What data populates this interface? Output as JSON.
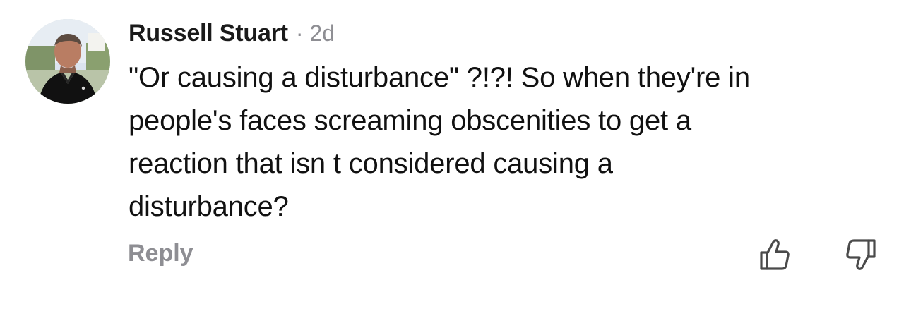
{
  "comment": {
    "author": "Russell Stuart",
    "separator": "·",
    "time": "2d",
    "body_lines": [
      "\"Or causing a disturbance\" ?!?! So when they're in",
      "people's faces screaming obscenities to get a",
      "reaction that isn t considered causing a",
      "disturbance?"
    ],
    "reply_label": "Reply"
  },
  "icons": {
    "avatar": "profile-photo",
    "like": "thumbs-up-icon",
    "dislike": "thumbs-down-icon"
  },
  "colors": {
    "text": "#111111",
    "muted": "#8e8e93"
  }
}
